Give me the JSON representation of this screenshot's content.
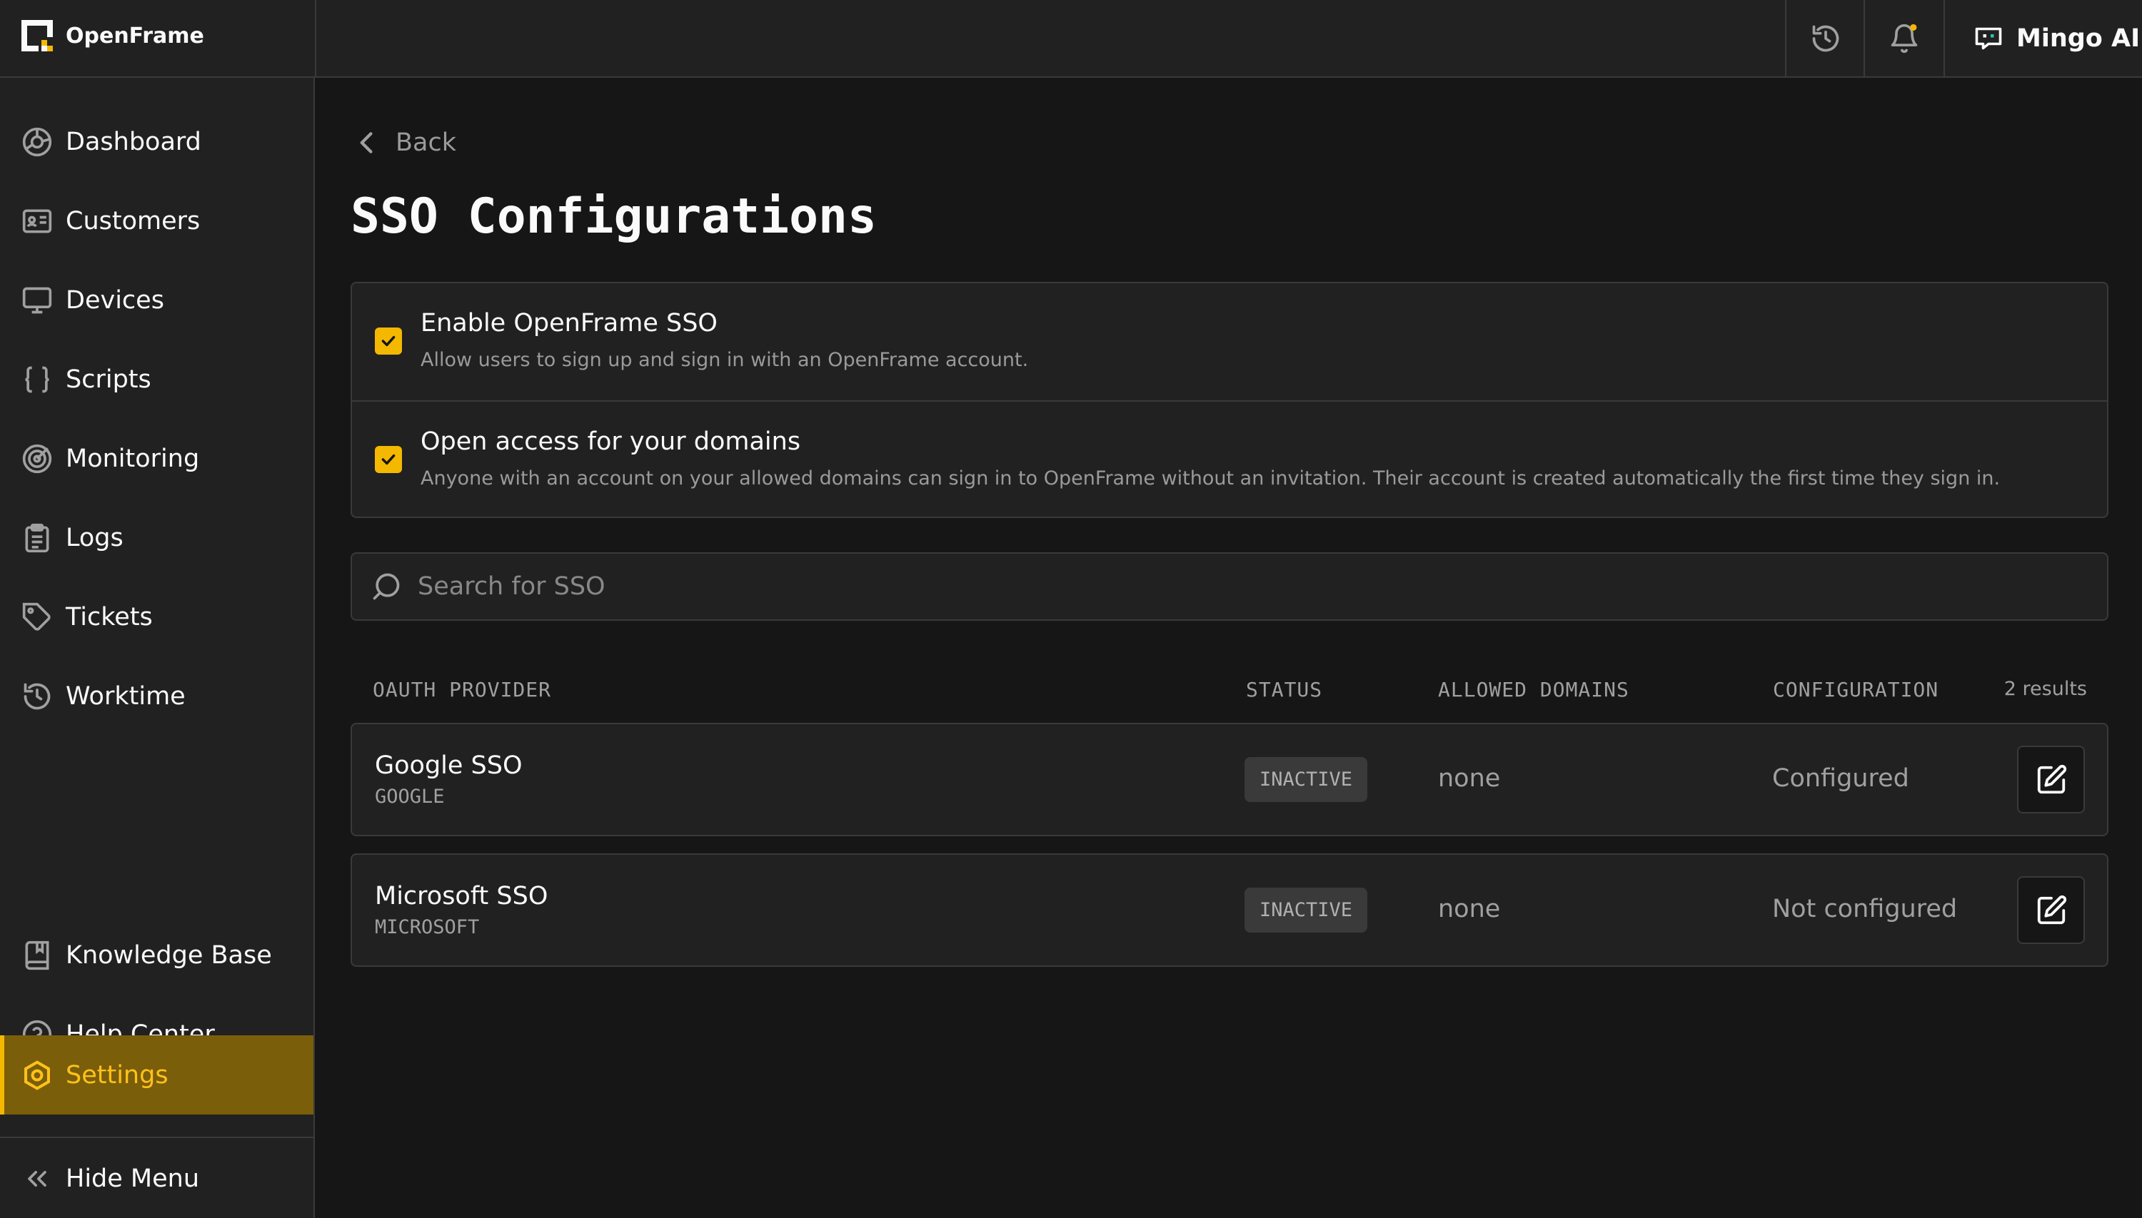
{
  "app": {
    "name": "OpenFrame"
  },
  "topbar": {
    "assistant_label": "Mingo AI"
  },
  "sidebar": {
    "items": [
      {
        "label": "Dashboard",
        "icon": "dashboard-icon"
      },
      {
        "label": "Customers",
        "icon": "customers-icon"
      },
      {
        "label": "Devices",
        "icon": "monitor-icon"
      },
      {
        "label": "Scripts",
        "icon": "braces-icon"
      },
      {
        "label": "Monitoring",
        "icon": "target-icon"
      },
      {
        "label": "Logs",
        "icon": "clipboard-icon"
      },
      {
        "label": "Tickets",
        "icon": "tag-icon"
      },
      {
        "label": "Worktime",
        "icon": "history-icon"
      }
    ],
    "bottom_items": [
      {
        "label": "Knowledge Base",
        "icon": "book-icon"
      },
      {
        "label": "Help Center",
        "icon": "help-icon"
      },
      {
        "label": "Settings",
        "icon": "settings-icon",
        "active": true
      }
    ],
    "hide_menu_label": "Hide Menu"
  },
  "main": {
    "back_label": "Back",
    "title": "SSO Configurations",
    "options": [
      {
        "title": "Enable OpenFrame SSO",
        "description": "Allow users to sign up and sign in with an OpenFrame account.",
        "checked": true
      },
      {
        "title": "Open access for your domains",
        "description": "Anyone with an account on your allowed domains can sign in to OpenFrame without an invitation. Their account is created automatically the first time they sign in.",
        "checked": true
      }
    ],
    "search": {
      "placeholder": "Search for SSO",
      "value": ""
    },
    "table": {
      "headers": {
        "provider": "OAUTH PROVIDER",
        "status": "STATUS",
        "domains": "ALLOWED DOMAINS",
        "configuration": "CONFIGURATION"
      },
      "results_count": "2 results",
      "rows": [
        {
          "name": "Google SSO",
          "provider": "GOOGLE",
          "status": "INACTIVE",
          "domains": "none",
          "configuration": "Configured"
        },
        {
          "name": "Microsoft SSO",
          "provider": "MICROSOFT",
          "status": "INACTIVE",
          "domains": "none",
          "configuration": "Not configured"
        }
      ]
    }
  },
  "colors": {
    "accent": "#f5b800",
    "active_bg": "#7a5e0a",
    "background": "#161616",
    "panel": "#212121",
    "border": "#3a3a3a"
  }
}
